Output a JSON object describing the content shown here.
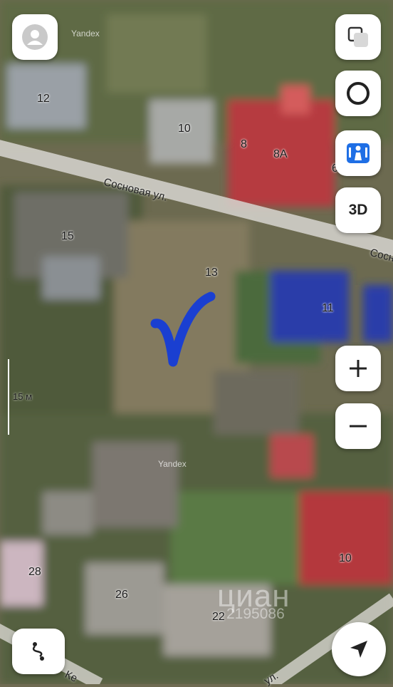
{
  "map": {
    "watermark_top": "Yandex",
    "watermark_mid": "Yandex",
    "street_sosnovaya": "Сосновая ул.",
    "street_sosnovaya_right": "Сосн",
    "street_bottom_left": "Ке",
    "street_bottom_right": "ул.",
    "scale_label": "15 м",
    "house_numbers": {
      "n12": "12",
      "n10_top": "10",
      "n8": "8",
      "n8a": "8А",
      "n6": "6",
      "n15": "15",
      "n13": "13",
      "n11": "11",
      "n10_bottom": "10",
      "n28": "28",
      "n26": "26",
      "n22": "22"
    },
    "overlay_watermark": "циан",
    "overlay_id": "2195086"
  },
  "controls": {
    "three_d_label": "3D"
  },
  "colors": {
    "accent_blue": "#1a3fd1",
    "layers_blue": "#1f6fe5"
  }
}
